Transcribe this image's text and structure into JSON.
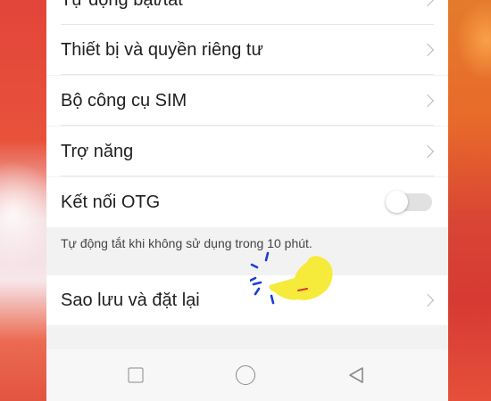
{
  "settings": {
    "items": [
      {
        "label": "Tự động bật/tắt",
        "control": "chevron"
      },
      {
        "label": "Thiết bị và quyền riêng tư",
        "control": "chevron"
      },
      {
        "label": "Bộ công cụ SIM",
        "control": "chevron"
      },
      {
        "label": "Trợ năng",
        "control": "chevron"
      },
      {
        "label": "Kết nối OTG",
        "control": "toggle",
        "toggle_on": false
      }
    ],
    "otg_note": "Tự động tắt khi không sử dụng trong 10 phút.",
    "backup_item": {
      "label": "Sao lưu và đặt lại",
      "control": "chevron"
    }
  },
  "navbar": {
    "buttons": [
      {
        "icon": "recents-square-icon"
      },
      {
        "icon": "home-circle-icon"
      },
      {
        "icon": "back-triangle-icon"
      }
    ]
  },
  "colors": {
    "highlight_hand": "#f6ea3a",
    "tap_rays": "#1a3fd6"
  }
}
